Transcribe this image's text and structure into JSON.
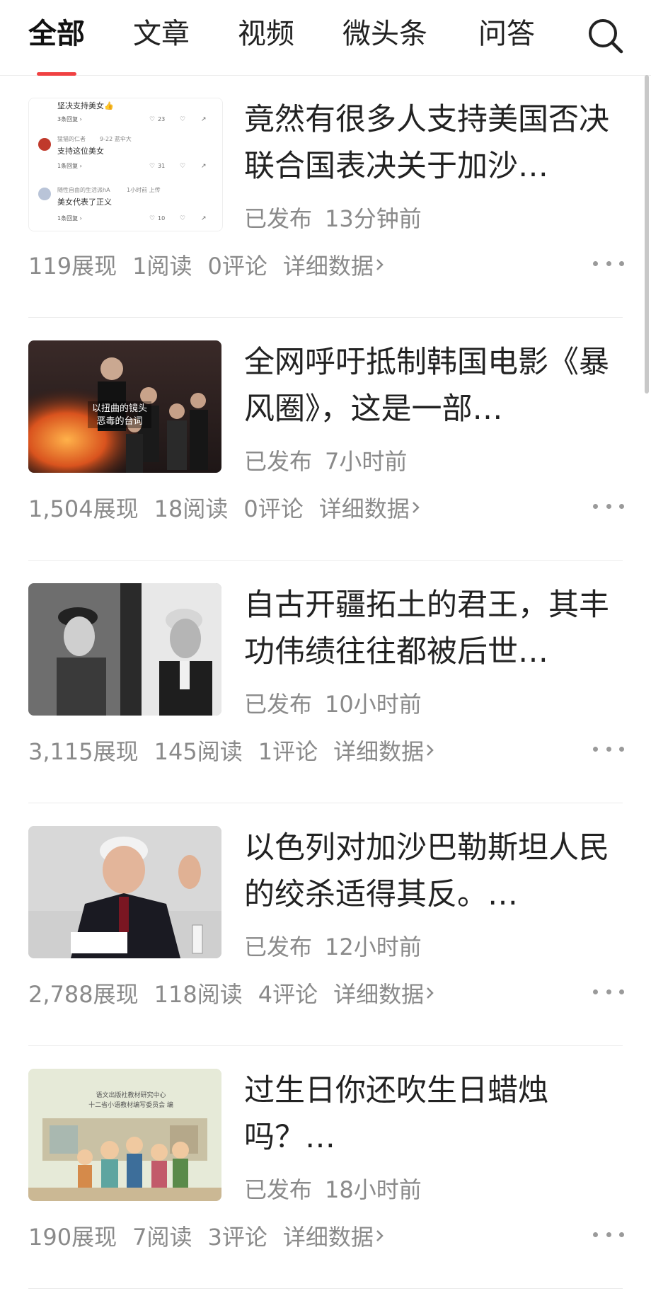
{
  "tabs": [
    {
      "label": "全部",
      "active": true
    },
    {
      "label": "文章",
      "active": false
    },
    {
      "label": "视频",
      "active": false
    },
    {
      "label": "微头条",
      "active": false
    },
    {
      "label": "问答",
      "active": false
    }
  ],
  "search_icon": "search-icon",
  "accent_color": "#f04142",
  "articles": [
    {
      "title": "竟然有很多人支持美国否决联合国表决关于加沙…",
      "status": "已发布",
      "time": "13分钟前",
      "views": "119展现",
      "reads": "1阅读",
      "comments": "0评论",
      "detail": "详细数据",
      "thumb": {
        "comments": [
          {
            "name": "",
            "time": "",
            "text": "坚决支持美女👍",
            "replies": "3条回复 ›",
            "likes": "23"
          },
          {
            "name": "猛猫的仁者",
            "time": "9-22 蓝伞大",
            "text": "支持这位美女",
            "replies": "1条回复 ›",
            "likes": "31"
          },
          {
            "name": "随性自由的生活派hA",
            "time": "1小时前 上传",
            "text": "美女代表了正义",
            "replies": "1条回复 ›",
            "likes": "10"
          }
        ]
      }
    },
    {
      "title": "全网呼吁抵制韩国电影《暴风圈》，这是一部…",
      "status": "已发布",
      "time": "7小时前",
      "views": "1,504展现",
      "reads": "18阅读",
      "comments": "0评论",
      "detail": "详细数据",
      "thumb": {
        "caption_1": "以扭曲的镜头",
        "caption_2": "恶毒的台词"
      }
    },
    {
      "title": "自古开疆拓土的君王，其丰功伟绩往往都被后世…",
      "status": "已发布",
      "time": "10小时前",
      "views": "3,115展现",
      "reads": "145阅读",
      "comments": "1评论",
      "detail": "详细数据",
      "thumb": {}
    },
    {
      "title": "以色列对加沙巴勒斯坦人民的绞杀适得其反。…",
      "status": "已发布",
      "time": "12小时前",
      "views": "2,788展现",
      "reads": "118阅读",
      "comments": "4评论",
      "detail": "详细数据",
      "thumb": {}
    },
    {
      "title": "过生日你还吹生日蜡烛吗？…",
      "status": "已发布",
      "time": "18小时前",
      "views": "190展现",
      "reads": "7阅读",
      "comments": "3评论",
      "detail": "详细数据",
      "thumb": {
        "line_1": "语文出版社教材研究中心",
        "line_2": "十二省小语教材编写委员会 编"
      }
    }
  ]
}
